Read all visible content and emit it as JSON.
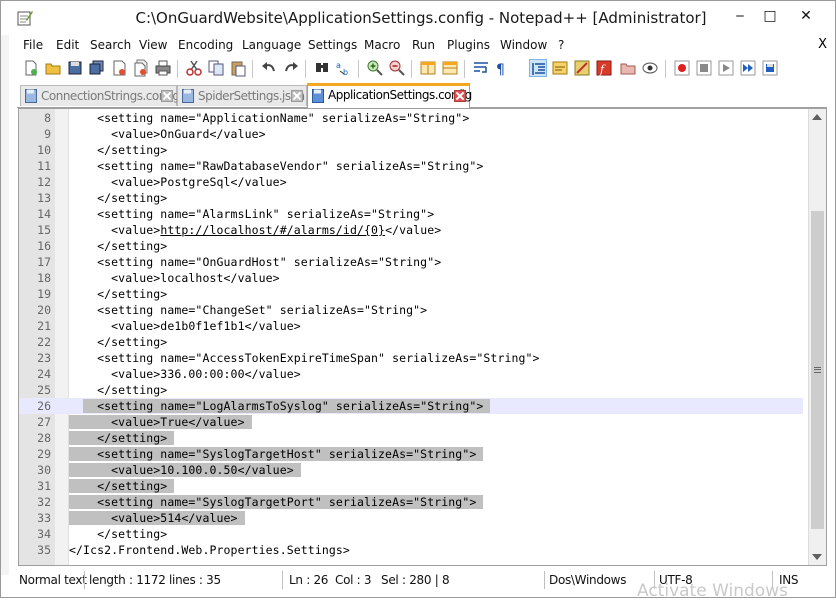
{
  "window": {
    "title": "C:\\OnGuardWebsite\\ApplicationSettings.config - Notepad++ [Administrator]",
    "controls": {
      "minimize": "‒",
      "maximize": "□",
      "close": "✕"
    }
  },
  "menu": [
    "File",
    "Edit",
    "Search",
    "View",
    "Encoding",
    "Language",
    "Settings",
    "Macro",
    "Run",
    "Plugins",
    "Window",
    "?"
  ],
  "menu_close": "X",
  "toolbar_icons": [
    "new-file-icon",
    "open-file-icon",
    "save-icon",
    "save-all-icon",
    "close-icon",
    "close-all-icon",
    "print-icon",
    "cut-icon",
    "copy-icon",
    "paste-icon",
    "undo-icon",
    "redo-icon",
    "find-icon",
    "replace-icon",
    "zoom-in-icon",
    "zoom-out-icon",
    "sync-vertical-icon",
    "sync-horizontal-icon",
    "word-wrap-icon",
    "show-all-chars-icon",
    "indent-guide-icon",
    "user-language-icon",
    "doc-map-icon",
    "function-list-icon",
    "folder-workspace-icon",
    "monitoring-icon",
    "record-macro-icon",
    "stop-macro-icon",
    "play-macro-icon",
    "run-macro-multiple-icon",
    "save-macro-icon"
  ],
  "tabs": [
    {
      "label": "ConnectionStrings.config",
      "active": false
    },
    {
      "label": "SpiderSettings.json",
      "active": false
    },
    {
      "label": "ApplicationSettings.config",
      "active": true
    }
  ],
  "editor": {
    "current_line": 26,
    "lines": [
      {
        "n": "8",
        "text": "    <setting name=\"ApplicationName\" serializeAs=\"String\">",
        "sel": false
      },
      {
        "n": "9",
        "text": "      <value>OnGuard</value>",
        "sel": false
      },
      {
        "n": "10",
        "text": "    </setting>",
        "sel": false
      },
      {
        "n": "11",
        "text": "    <setting name=\"RawDatabaseVendor\" serializeAs=\"String\">",
        "sel": false
      },
      {
        "n": "12",
        "text": "      <value>PostgreSql</value>",
        "sel": false
      },
      {
        "n": "13",
        "text": "    </setting>",
        "sel": false
      },
      {
        "n": "14",
        "text": "    <setting name=\"AlarmsLink\" serializeAs=\"String\">",
        "sel": false
      },
      {
        "n": "15",
        "text": "      <value>http://localhost/#/alarms/id/{0}</value>",
        "sel": false,
        "url": "http://localhost/#/alarms/id/{0}"
      },
      {
        "n": "16",
        "text": "    </setting>",
        "sel": false
      },
      {
        "n": "17",
        "text": "    <setting name=\"OnGuardHost\" serializeAs=\"String\">",
        "sel": false
      },
      {
        "n": "18",
        "text": "      <value>localhost</value>",
        "sel": false
      },
      {
        "n": "19",
        "text": "    </setting>",
        "sel": false
      },
      {
        "n": "20",
        "text": "    <setting name=\"ChangeSet\" serializeAs=\"String\">",
        "sel": false
      },
      {
        "n": "21",
        "text": "      <value>de1b0f1ef1b1</value>",
        "sel": false
      },
      {
        "n": "22",
        "text": "    </setting>",
        "sel": false
      },
      {
        "n": "23",
        "text": "    <setting name=\"AccessTokenExpireTimeSpan\" serializeAs=\"String\">",
        "sel": false
      },
      {
        "n": "24",
        "text": "      <value>336.00:00:00</value>",
        "sel": false
      },
      {
        "n": "25",
        "text": "    </setting>",
        "sel": false
      },
      {
        "n": "26",
        "text": "    <setting name=\"LogAlarmsToSyslog\" serializeAs=\"String\">",
        "sel": true
      },
      {
        "n": "27",
        "text": "      <value>True</value>",
        "sel": true
      },
      {
        "n": "28",
        "text": "    </setting>",
        "sel": true
      },
      {
        "n": "29",
        "text": "    <setting name=\"SyslogTargetHost\" serializeAs=\"String\">",
        "sel": true
      },
      {
        "n": "30",
        "text": "      <value>10.100.0.50</value>",
        "sel": true
      },
      {
        "n": "31",
        "text": "    </setting>",
        "sel": true
      },
      {
        "n": "32",
        "text": "    <setting name=\"SyslogTargetPort\" serializeAs=\"String\">",
        "sel": true
      },
      {
        "n": "33",
        "text": "      <value>514</value>",
        "sel": true
      },
      {
        "n": "34",
        "text": "    </setting>",
        "sel": false
      },
      {
        "n": "35",
        "text": "</Ics2.Frontend.Web.Properties.Settings>",
        "sel": false
      }
    ]
  },
  "status": {
    "type": "Normal text",
    "length": "length : 1172",
    "lines": "lines : 35",
    "ln": "Ln : 26",
    "col": "Col : 3",
    "sel": "Sel : 280 | 8",
    "eol": "Dos\\Windows",
    "encoding": "UTF-8",
    "mode": "INS"
  },
  "watermark": "Activate Windows",
  "colors": {
    "selection": "#c0c0c0",
    "current_line": "#e8e8ff",
    "active_tab_accent": "#f5a623",
    "gutter": "#e4e4e4"
  }
}
